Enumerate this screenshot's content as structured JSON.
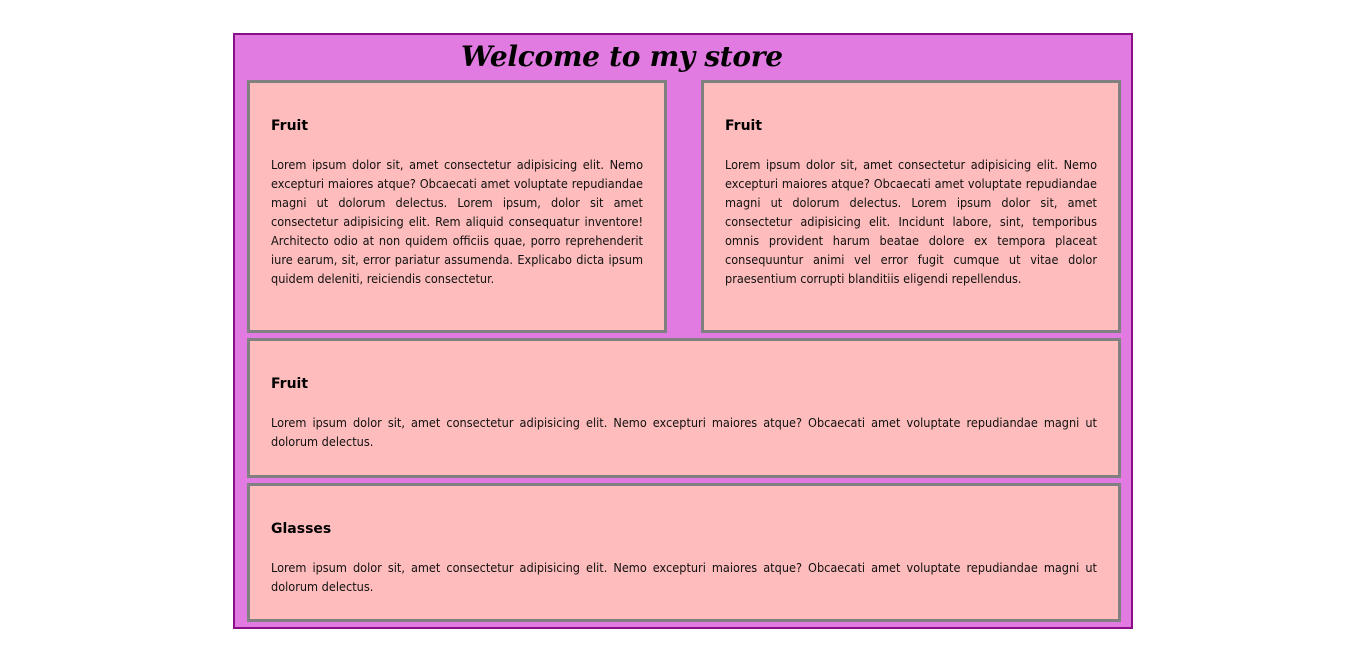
{
  "page": {
    "title": "Welcome to my store"
  },
  "cards": [
    {
      "title": "Fruit",
      "text": "Lorem ipsum dolor sit, amet consectetur adipisicing elit. Nemo excepturi maiores atque? Obcaecati amet voluptate repudiandae magni ut dolorum delectus. Lorem ipsum, dolor sit amet consectetur adipisicing elit. Rem aliquid consequatur inventore! Architecto odio at non quidem officiis quae, porro reprehenderit iure earum, sit, error pariatur assumenda. Explicabo dicta ipsum quidem deleniti, reiciendis consectetur."
    },
    {
      "title": "Fruit",
      "text": "Lorem ipsum dolor sit, amet consectetur adipisicing elit. Nemo excepturi maiores atque? Obcaecati amet voluptate repudiandae magni ut dolorum delectus. Lorem ipsum dolor sit, amet consectetur adipisicing elit. Incidunt labore, sint, temporibus omnis provident harum beatae dolore ex tempora placeat consequuntur animi vel error fugit cumque ut vitae dolor praesentium corrupti blanditiis eligendi repellendus."
    },
    {
      "title": "Fruit",
      "text": "Lorem ipsum dolor sit, amet consectetur adipisicing elit. Nemo excepturi maiores atque? Obcaecati amet voluptate repudiandae magni ut dolorum delectus."
    },
    {
      "title": "Glasses",
      "text": "Lorem ipsum dolor sit, amet consectetur adipisicing elit. Nemo excepturi maiores atque? Obcaecati amet voluptate repudiandae magni ut dolorum delectus."
    }
  ],
  "colors": {
    "page_background": "#ffffff",
    "store_background": "#e17ae1",
    "store_border": "#8a0d8a",
    "card_background": "#febcbc",
    "card_border": "#808080"
  }
}
